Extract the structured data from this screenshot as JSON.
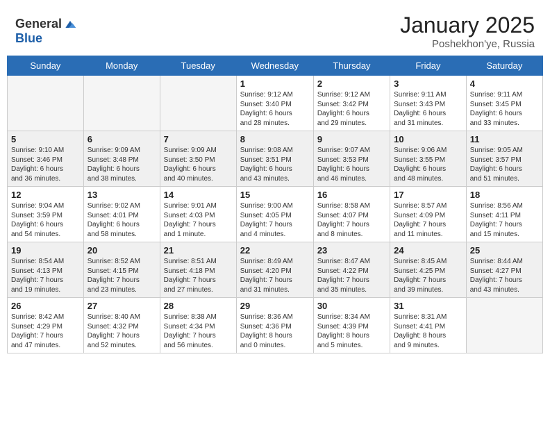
{
  "header": {
    "logo_general": "General",
    "logo_blue": "Blue",
    "month_year": "January 2025",
    "location": "Poshekhon'ye, Russia"
  },
  "days_of_week": [
    "Sunday",
    "Monday",
    "Tuesday",
    "Wednesday",
    "Thursday",
    "Friday",
    "Saturday"
  ],
  "weeks": [
    {
      "shaded": false,
      "days": [
        {
          "number": "",
          "info": ""
        },
        {
          "number": "",
          "info": ""
        },
        {
          "number": "",
          "info": ""
        },
        {
          "number": "1",
          "info": "Sunrise: 9:12 AM\nSunset: 3:40 PM\nDaylight: 6 hours\nand 28 minutes."
        },
        {
          "number": "2",
          "info": "Sunrise: 9:12 AM\nSunset: 3:42 PM\nDaylight: 6 hours\nand 29 minutes."
        },
        {
          "number": "3",
          "info": "Sunrise: 9:11 AM\nSunset: 3:43 PM\nDaylight: 6 hours\nand 31 minutes."
        },
        {
          "number": "4",
          "info": "Sunrise: 9:11 AM\nSunset: 3:45 PM\nDaylight: 6 hours\nand 33 minutes."
        }
      ]
    },
    {
      "shaded": true,
      "days": [
        {
          "number": "5",
          "info": "Sunrise: 9:10 AM\nSunset: 3:46 PM\nDaylight: 6 hours\nand 36 minutes."
        },
        {
          "number": "6",
          "info": "Sunrise: 9:09 AM\nSunset: 3:48 PM\nDaylight: 6 hours\nand 38 minutes."
        },
        {
          "number": "7",
          "info": "Sunrise: 9:09 AM\nSunset: 3:50 PM\nDaylight: 6 hours\nand 40 minutes."
        },
        {
          "number": "8",
          "info": "Sunrise: 9:08 AM\nSunset: 3:51 PM\nDaylight: 6 hours\nand 43 minutes."
        },
        {
          "number": "9",
          "info": "Sunrise: 9:07 AM\nSunset: 3:53 PM\nDaylight: 6 hours\nand 46 minutes."
        },
        {
          "number": "10",
          "info": "Sunrise: 9:06 AM\nSunset: 3:55 PM\nDaylight: 6 hours\nand 48 minutes."
        },
        {
          "number": "11",
          "info": "Sunrise: 9:05 AM\nSunset: 3:57 PM\nDaylight: 6 hours\nand 51 minutes."
        }
      ]
    },
    {
      "shaded": false,
      "days": [
        {
          "number": "12",
          "info": "Sunrise: 9:04 AM\nSunset: 3:59 PM\nDaylight: 6 hours\nand 54 minutes."
        },
        {
          "number": "13",
          "info": "Sunrise: 9:02 AM\nSunset: 4:01 PM\nDaylight: 6 hours\nand 58 minutes."
        },
        {
          "number": "14",
          "info": "Sunrise: 9:01 AM\nSunset: 4:03 PM\nDaylight: 7 hours\nand 1 minute."
        },
        {
          "number": "15",
          "info": "Sunrise: 9:00 AM\nSunset: 4:05 PM\nDaylight: 7 hours\nand 4 minutes."
        },
        {
          "number": "16",
          "info": "Sunrise: 8:58 AM\nSunset: 4:07 PM\nDaylight: 7 hours\nand 8 minutes."
        },
        {
          "number": "17",
          "info": "Sunrise: 8:57 AM\nSunset: 4:09 PM\nDaylight: 7 hours\nand 11 minutes."
        },
        {
          "number": "18",
          "info": "Sunrise: 8:56 AM\nSunset: 4:11 PM\nDaylight: 7 hours\nand 15 minutes."
        }
      ]
    },
    {
      "shaded": true,
      "days": [
        {
          "number": "19",
          "info": "Sunrise: 8:54 AM\nSunset: 4:13 PM\nDaylight: 7 hours\nand 19 minutes."
        },
        {
          "number": "20",
          "info": "Sunrise: 8:52 AM\nSunset: 4:15 PM\nDaylight: 7 hours\nand 23 minutes."
        },
        {
          "number": "21",
          "info": "Sunrise: 8:51 AM\nSunset: 4:18 PM\nDaylight: 7 hours\nand 27 minutes."
        },
        {
          "number": "22",
          "info": "Sunrise: 8:49 AM\nSunset: 4:20 PM\nDaylight: 7 hours\nand 31 minutes."
        },
        {
          "number": "23",
          "info": "Sunrise: 8:47 AM\nSunset: 4:22 PM\nDaylight: 7 hours\nand 35 minutes."
        },
        {
          "number": "24",
          "info": "Sunrise: 8:45 AM\nSunset: 4:25 PM\nDaylight: 7 hours\nand 39 minutes."
        },
        {
          "number": "25",
          "info": "Sunrise: 8:44 AM\nSunset: 4:27 PM\nDaylight: 7 hours\nand 43 minutes."
        }
      ]
    },
    {
      "shaded": false,
      "days": [
        {
          "number": "26",
          "info": "Sunrise: 8:42 AM\nSunset: 4:29 PM\nDaylight: 7 hours\nand 47 minutes."
        },
        {
          "number": "27",
          "info": "Sunrise: 8:40 AM\nSunset: 4:32 PM\nDaylight: 7 hours\nand 52 minutes."
        },
        {
          "number": "28",
          "info": "Sunrise: 8:38 AM\nSunset: 4:34 PM\nDaylight: 7 hours\nand 56 minutes."
        },
        {
          "number": "29",
          "info": "Sunrise: 8:36 AM\nSunset: 4:36 PM\nDaylight: 8 hours\nand 0 minutes."
        },
        {
          "number": "30",
          "info": "Sunrise: 8:34 AM\nSunset: 4:39 PM\nDaylight: 8 hours\nand 5 minutes."
        },
        {
          "number": "31",
          "info": "Sunrise: 8:31 AM\nSunset: 4:41 PM\nDaylight: 8 hours\nand 9 minutes."
        },
        {
          "number": "",
          "info": ""
        }
      ]
    }
  ]
}
